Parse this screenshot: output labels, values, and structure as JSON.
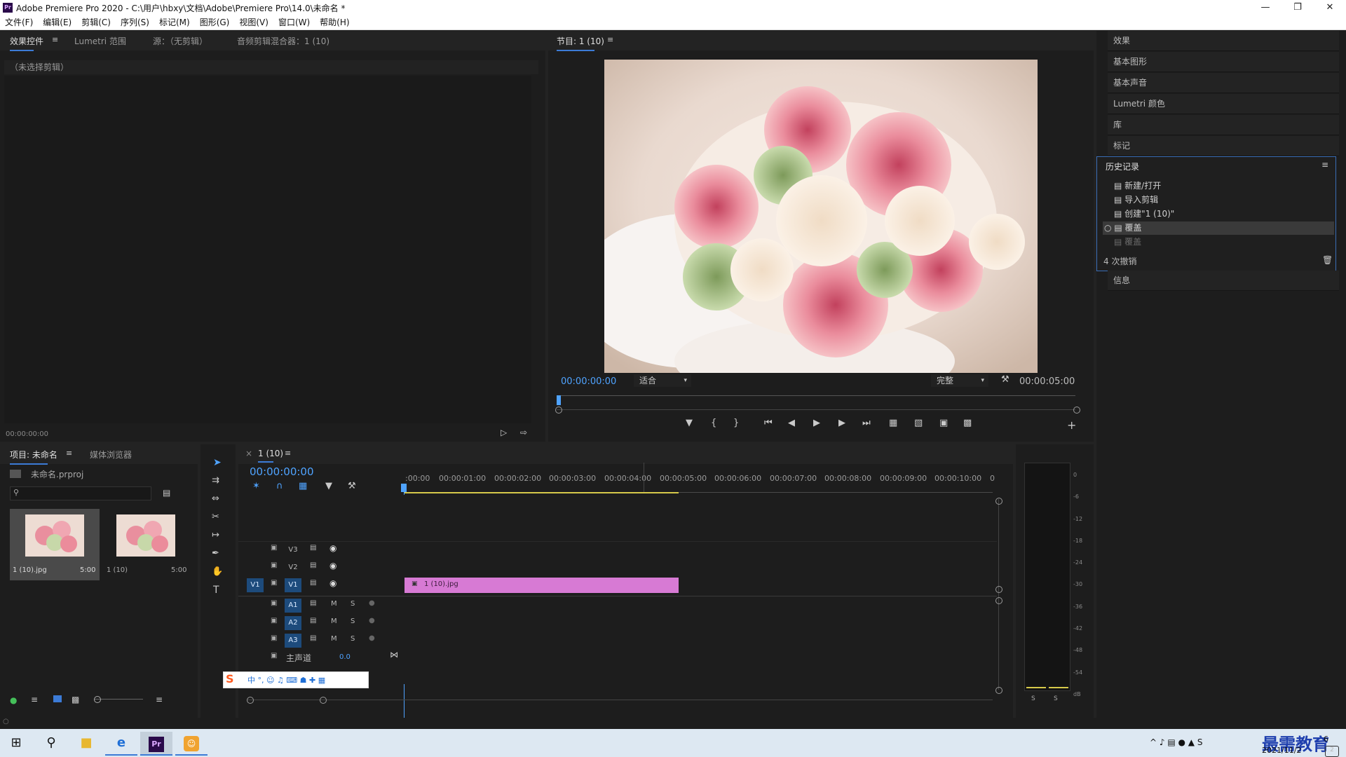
{
  "window": {
    "title": "Adobe Premiere Pro 2020 - C:\\用户\\hbxy\\文档\\Adobe\\Premiere Pro\\14.0\\未命名 *",
    "app_icon": "Pr"
  },
  "menu": [
    "文件(F)",
    "编辑(E)",
    "剪辑(C)",
    "序列(S)",
    "标记(M)",
    "图形(G)",
    "视图(V)",
    "窗口(W)",
    "帮助(H)"
  ],
  "source_panel": {
    "tabs": [
      "效果控件",
      "Lumetri 范围",
      "源：（无剪辑）",
      "音频剪辑混合器：1 (10)"
    ],
    "no_clip": "（未选择剪辑）",
    "timecode": "00:00:00:00"
  },
  "program": {
    "tab": "节目: 1 (10)",
    "timecode_left": "00:00:00:00",
    "fit": "适合",
    "quality": "完整",
    "timecode_right": "00:00:05:00"
  },
  "right_panels": {
    "items_top": [
      "效果",
      "基本图形",
      "基本声音",
      "Lumetri 颜色",
      "库",
      "标记"
    ],
    "history_title": "历史记录",
    "history_items": [
      "新建/打开",
      "导入剪辑",
      "创建\"1 (10)\"",
      "覆盖",
      "覆盖"
    ],
    "history_undos": "4 次撤销",
    "info": "信息"
  },
  "project": {
    "tabs": [
      "项目: 未命名",
      "媒体浏览器"
    ],
    "file": "未命名.prproj",
    "search_placeholder": "",
    "items": [
      {
        "name": "1 (10).jpg",
        "duration": "5:00"
      },
      {
        "name": "1 (10)",
        "duration": "5:00"
      }
    ]
  },
  "timeline": {
    "tab": "1 (10)",
    "timecode": "00:00:00:00",
    "ruler": [
      ":00:00",
      "00:00:01:00",
      "00:00:02:00",
      "00:00:03:00",
      "00:00:04:00",
      "00:00:05:00",
      "00:00:06:00",
      "00:00:07:00",
      "00:00:08:00",
      "00:00:09:00",
      "00:00:10:00",
      "0"
    ],
    "video_tracks": [
      "V3",
      "V2",
      "V1"
    ],
    "audio_tracks": [
      "A1",
      "A2",
      "A3"
    ],
    "master": "主声道",
    "master_value": "0.0",
    "clip_name": "1 (10).jpg",
    "source_patch": "V1",
    "mute": "M",
    "solo": "S"
  },
  "meter": {
    "scale": [
      "0",
      "-6",
      "-12",
      "-18",
      "-24",
      "-30",
      "-36",
      "-42",
      "-48",
      "-54",
      "dB"
    ],
    "solo_labels": [
      "S",
      "S"
    ]
  },
  "taskbar": {
    "date": "2021/11/2",
    "watermark": "最需教育",
    "time_partial": "6"
  },
  "colors": {
    "accent": "#4fa3ff",
    "clip": "#d77ad4",
    "tab_underline": "#3c7bd6"
  }
}
